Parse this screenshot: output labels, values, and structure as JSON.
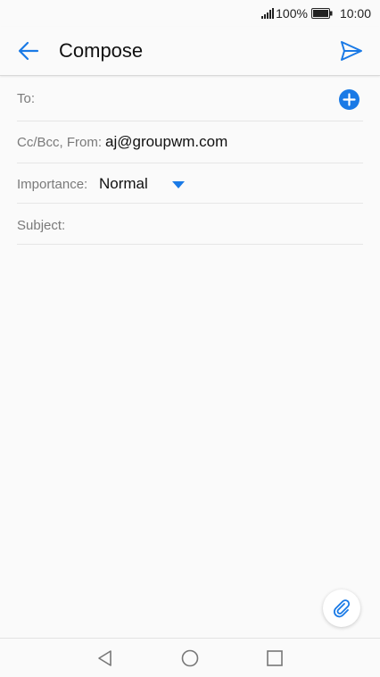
{
  "status_bar": {
    "battery_percent": "100%",
    "time": "10:00"
  },
  "app_bar": {
    "title": "Compose"
  },
  "fields": {
    "to_label": "To:",
    "ccbcc_label": "Cc/Bcc, From:",
    "from_value": "aj@groupwm.com",
    "importance_label": "Importance:",
    "importance_value": "Normal",
    "subject_label": "Subject:"
  },
  "icons": {
    "back": "arrow-left-icon",
    "send": "send-icon",
    "add": "add-recipient-icon",
    "dropdown": "dropdown-arrow-icon",
    "attach": "paperclip-icon",
    "nav_back": "triangle-back-icon",
    "nav_home": "circle-home-icon",
    "nav_recent": "square-recent-icon"
  },
  "colors": {
    "accent": "#1a7ae6"
  }
}
